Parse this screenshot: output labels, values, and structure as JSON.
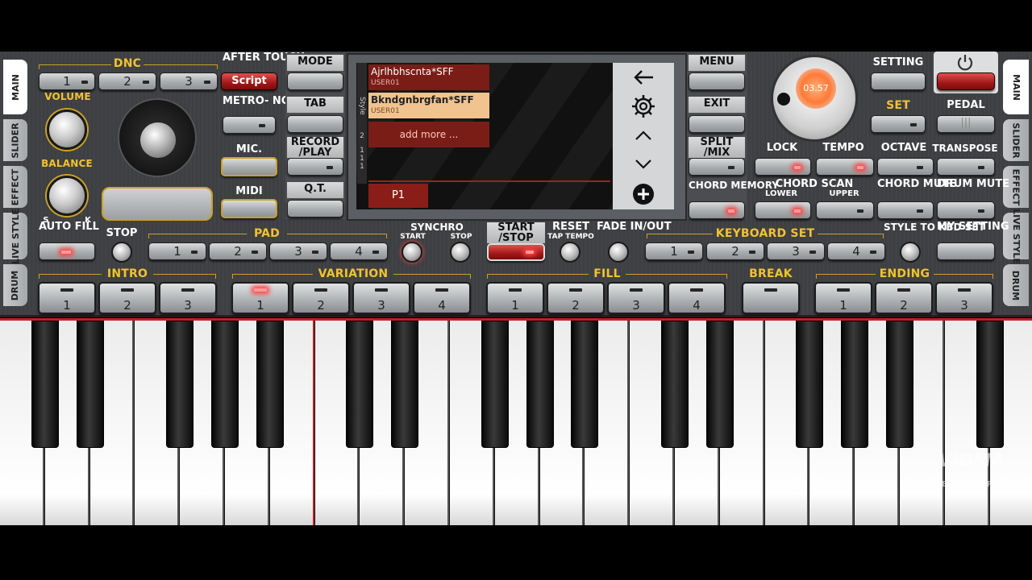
{
  "left_panel": {
    "dnc_label": "DNC",
    "dnc_buttons": [
      "1",
      "2",
      "3"
    ],
    "script_button": "Script",
    "after_touch": "AFTER TOUCH",
    "metronome": "METRO- NOME",
    "mic": "MIC.",
    "midi": "MIDI",
    "volume": "VOLUME",
    "balance": "BALANCE",
    "auto_fill": "AUTO FILL",
    "knob_s": "S",
    "knob_k": "K"
  },
  "side_tabs_left": [
    "MAIN",
    "SLIDER",
    "EFFECT",
    "LIVE STYLE",
    "DRUM"
  ],
  "side_tabs_right": [
    "MAIN",
    "SLIDER",
    "EFFECT",
    "LIVE STYLE",
    "DRUM"
  ],
  "mode_column": {
    "mode": "MODE",
    "tab": "TAB",
    "record": "RECORD /PLAY",
    "qt": "Q.T."
  },
  "screen": {
    "style_label": "Style",
    "style_numbers": [
      "2",
      "1",
      "1",
      "1"
    ],
    "items": [
      {
        "name": "Ajrlhbhscnta*SFF",
        "sub": "USER01"
      },
      {
        "name": "Bkndgnbrgfan*SFF",
        "sub": "USER01"
      }
    ],
    "add_more": "add more ...",
    "pad_label": "P1"
  },
  "right_column": {
    "menu": "MENU",
    "exit": "EXIT",
    "split_mix": "SPLIT /MIX",
    "chord_memory": "CHORD MEMORY"
  },
  "tempo_display": "03.57",
  "right_panel": {
    "setting": "SETTING",
    "set": "SET",
    "pedal": "PEDAL",
    "lock": "LOCK",
    "tempo": "TEMPO",
    "octave": "OCTAVE",
    "transpose": "TRANSPOSE",
    "chord_scan": "CHORD SCAN",
    "lower": "LOWER",
    "upper": "UPPER",
    "chord_mute": "CHORD MUTE",
    "drum_mute": "DRUM MUTE"
  },
  "row3": {
    "stop": "STOP",
    "pad": "PAD",
    "pad_buttons": [
      "1",
      "2",
      "3",
      "4"
    ],
    "synchro": "SYNCHRO",
    "synchro_start": "START",
    "synchro_stop": "STOP",
    "start_stop": "START /STOP",
    "reset": "RESET",
    "tap_tempo": "TAP TEMPO",
    "fade": "FADE IN/OUT",
    "keyboard_set": "KEYBOARD SET",
    "kbd_buttons": [
      "1",
      "2",
      "3",
      "4"
    ],
    "style_to_kbd": "STYLE TO KBD SET",
    "my_setting": "MY SETTING"
  },
  "row4": {
    "intro": "INTRO",
    "intro_buttons": [
      "1",
      "2",
      "3"
    ],
    "variation": "VARIATION",
    "variation_buttons": [
      "1",
      "2",
      "3",
      "4"
    ],
    "fill": "FILL",
    "fill_buttons": [
      "1",
      "2",
      "3",
      "4"
    ],
    "break": "BREAK",
    "ending": "ENDING",
    "ending_buttons": [
      "1",
      "2",
      "3"
    ]
  },
  "watermark": {
    "brand": "VIDMA",
    "sub": "SCREEN RECORDER"
  },
  "colors": {
    "accent": "#f2c230",
    "led_on": "#ff4040",
    "panel": "#404245"
  }
}
